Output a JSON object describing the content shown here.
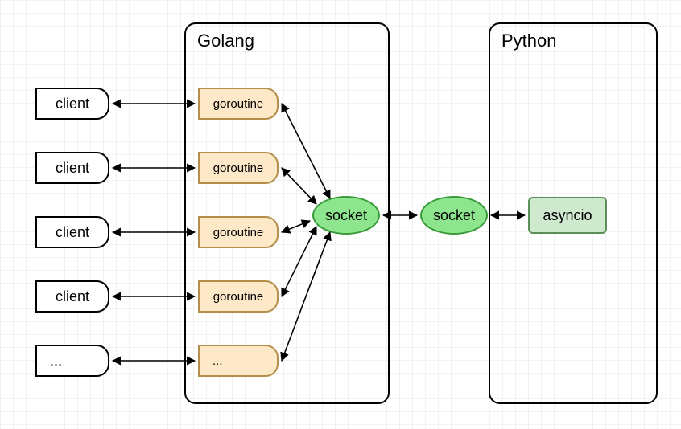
{
  "chart_data": {
    "type": "diagram",
    "containers": [
      {
        "id": "golang",
        "label": "Golang"
      },
      {
        "id": "python",
        "label": "Python"
      }
    ],
    "nodes": [
      {
        "id": "client1",
        "type": "client",
        "label": "client"
      },
      {
        "id": "client2",
        "type": "client",
        "label": "client"
      },
      {
        "id": "client3",
        "type": "client",
        "label": "client"
      },
      {
        "id": "client4",
        "type": "client",
        "label": "client"
      },
      {
        "id": "client5",
        "type": "client",
        "label": "..."
      },
      {
        "id": "goroutine1",
        "type": "goroutine",
        "label": "goroutine",
        "container": "golang"
      },
      {
        "id": "goroutine2",
        "type": "goroutine",
        "label": "goroutine",
        "container": "golang"
      },
      {
        "id": "goroutine3",
        "type": "goroutine",
        "label": "goroutine",
        "container": "golang"
      },
      {
        "id": "goroutine4",
        "type": "goroutine",
        "label": "goroutine",
        "container": "golang"
      },
      {
        "id": "goroutine5",
        "type": "goroutine",
        "label": "...",
        "container": "golang"
      },
      {
        "id": "socket1",
        "type": "socket",
        "label": "socket",
        "container": "golang"
      },
      {
        "id": "socket2",
        "type": "socket",
        "label": "socket",
        "container": "python"
      },
      {
        "id": "asyncio",
        "type": "asyncio",
        "label": "asyncio",
        "container": "python"
      }
    ],
    "edges": [
      {
        "from": "client1",
        "to": "goroutine1",
        "bidirectional": true
      },
      {
        "from": "client2",
        "to": "goroutine2",
        "bidirectional": true
      },
      {
        "from": "client3",
        "to": "goroutine3",
        "bidirectional": true
      },
      {
        "from": "client4",
        "to": "goroutine4",
        "bidirectional": true
      },
      {
        "from": "client5",
        "to": "goroutine5",
        "bidirectional": true
      },
      {
        "from": "goroutine1",
        "to": "socket1",
        "bidirectional": true
      },
      {
        "from": "goroutine2",
        "to": "socket1",
        "bidirectional": true
      },
      {
        "from": "goroutine3",
        "to": "socket1",
        "bidirectional": true
      },
      {
        "from": "goroutine4",
        "to": "socket1",
        "bidirectional": true
      },
      {
        "from": "goroutine5",
        "to": "socket1",
        "bidirectional": true
      },
      {
        "from": "socket1",
        "to": "socket2",
        "bidirectional": true
      },
      {
        "from": "socket2",
        "to": "asyncio",
        "bidirectional": true
      }
    ]
  }
}
